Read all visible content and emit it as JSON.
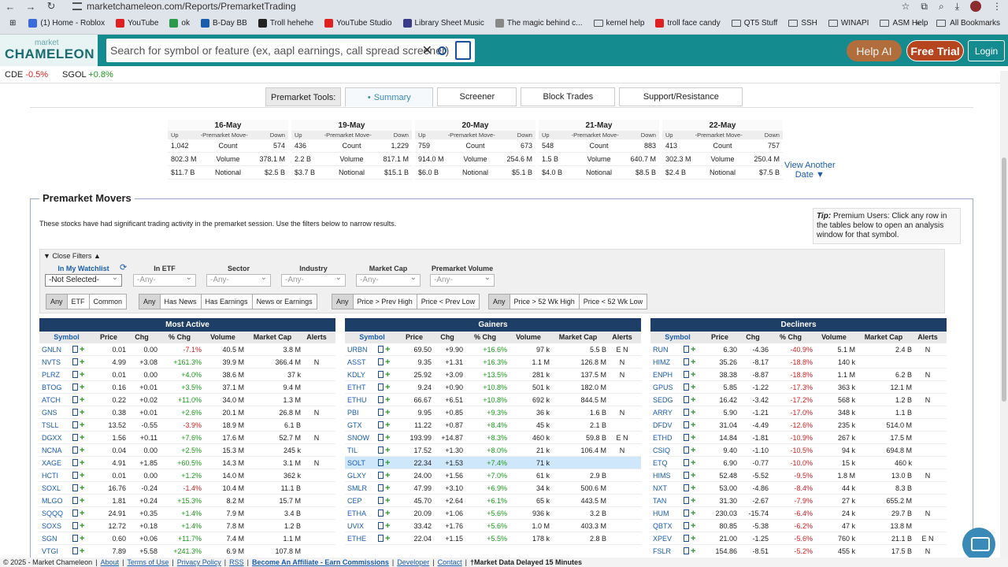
{
  "browser": {
    "url": "marketchameleon.com/Reports/PremarketTrading",
    "bookmarks": [
      "(1) Home - Roblox",
      "YouTube",
      "ok",
      "B-Day BB",
      "Troll hehehe",
      "YouTube Studio",
      "Library Sheet Music",
      "The magic behind c...",
      "kernel help",
      "troll face candy",
      "QT5 Stuff",
      "SSH",
      "WINAPI",
      "ASM Help"
    ],
    "all_bookmarks": "All Bookmarks",
    "bookmark_colors": [
      "#3a6bd8",
      "#e02020",
      "#2a9a4a",
      "#1a5cae",
      "#222",
      "#e02020",
      "#3a3a8a",
      "#888",
      "#555",
      "#e02020",
      "#555",
      "#555",
      "#555",
      "#555"
    ]
  },
  "header": {
    "logo_top": "market",
    "logo_main": "CHAMELEON",
    "search_placeholder": "Search for symbol or feature (ex, aapl earnings, call spread screener)",
    "help": "Help AI",
    "trial": "Free Trial",
    "login": "Login"
  },
  "tickers": [
    {
      "sym": "CDE",
      "chg": "-0.5%",
      "dir": "neg"
    },
    {
      "sym": "SGOL",
      "chg": "+0.8%",
      "dir": "pos"
    }
  ],
  "tabs": {
    "label": "Premarket Tools:",
    "items": [
      "Summary",
      "Screener",
      "Block Trades",
      "Support/Resistance"
    ]
  },
  "daycard_sub": [
    "Up",
    "-Premarket Move-",
    "Down"
  ],
  "days": [
    {
      "date": "16-May",
      "rows": [
        [
          "1,042",
          "Count",
          "574"
        ],
        [
          "802.3 M",
          "Volume",
          "378.1 M"
        ],
        [
          "$11.7 B",
          "Notional",
          "$2.5 B"
        ]
      ]
    },
    {
      "date": "19-May",
      "rows": [
        [
          "436",
          "Count",
          "1,229"
        ],
        [
          "2.2 B",
          "Volume",
          "817.1 M"
        ],
        [
          "$3.7 B",
          "Notional",
          "$15.1 B"
        ]
      ]
    },
    {
      "date": "20-May",
      "rows": [
        [
          "759",
          "Count",
          "673"
        ],
        [
          "914.0 M",
          "Volume",
          "254.6 M"
        ],
        [
          "$6.0 B",
          "Notional",
          "$5.1 B"
        ]
      ]
    },
    {
      "date": "21-May",
      "rows": [
        [
          "548",
          "Count",
          "883"
        ],
        [
          "1.5 B",
          "Volume",
          "640.7 M"
        ],
        [
          "$4.0 B",
          "Notional",
          "$8.5 B"
        ]
      ]
    },
    {
      "date": "22-May",
      "rows": [
        [
          "413",
          "Count",
          "757"
        ],
        [
          "302.3 M",
          "Volume",
          "250.4 M"
        ],
        [
          "$2.4 B",
          "Notional",
          "$7.5 B"
        ]
      ]
    }
  ],
  "view_another": [
    "View Another",
    "Date ▼"
  ],
  "movers": {
    "title": "Premarket Movers",
    "intro": "These stocks have had significant trading activity in the premarket session. Use the filters below to narrow results.",
    "tip_label": "Tip:",
    "tip_text": "Premium Users: Click any row in the tables below to open an analysis window for that symbol."
  },
  "filters": {
    "toggle": "Close Filters",
    "cols": [
      {
        "label": "In My Watchlist",
        "value": "-Not Selected-"
      },
      {
        "label": "In ETF",
        "value": "-Any-"
      },
      {
        "label": "Sector",
        "value": "-Any-"
      },
      {
        "label": "Industry",
        "value": "-Any-"
      },
      {
        "label": "Market Cap",
        "value": "-Any-"
      },
      {
        "label": "Premarket Volume",
        "value": "-Any-"
      }
    ],
    "groups": [
      [
        "Any",
        "ETF",
        "Common"
      ],
      [
        "Any",
        "Has News",
        "Has Earnings",
        "News or Earnings"
      ],
      [
        "Any",
        "Price > Prev High",
        "Price < Prev Low"
      ],
      [
        "Any",
        "Price > 52 Wk High",
        "Price < 52 Wk Low"
      ]
    ]
  },
  "table_headers": [
    "Symbol",
    "Price",
    "Chg",
    "% Chg",
    "Volume",
    "Market Cap",
    "Alerts"
  ],
  "tables": [
    {
      "title": "Most Active",
      "rows": [
        [
          "GNLN",
          "0.01",
          "0.00",
          "-7.1%",
          "40.5 M",
          "3.8 M",
          ""
        ],
        [
          "NVTS",
          "4.99",
          "+3.08",
          "+161.3%",
          "39.9 M",
          "366.4 M",
          "N"
        ],
        [
          "PLRZ",
          "0.01",
          "0.00",
          "+4.0%",
          "38.6 M",
          "37 k",
          ""
        ],
        [
          "BTOG",
          "0.16",
          "+0.01",
          "+3.5%",
          "37.1 M",
          "9.4 M",
          ""
        ],
        [
          "ATCH",
          "0.22",
          "+0.02",
          "+11.0%",
          "34.0 M",
          "1.3 M",
          ""
        ],
        [
          "GNS",
          "0.38",
          "+0.01",
          "+2.6%",
          "20.1 M",
          "26.8 M",
          "N"
        ],
        [
          "TSLL",
          "13.52",
          "-0.55",
          "-3.9%",
          "18.9 M",
          "6.1 B",
          ""
        ],
        [
          "DGXX",
          "1.56",
          "+0.11",
          "+7.6%",
          "17.6 M",
          "52.7 M",
          "N"
        ],
        [
          "NCNA",
          "0.04",
          "0.00",
          "+2.5%",
          "15.3 M",
          "245 k",
          ""
        ],
        [
          "XAGE",
          "4.91",
          "+1.85",
          "+60.5%",
          "14.3 M",
          "3.1 M",
          "N"
        ],
        [
          "HCTI",
          "0.01",
          "0.00",
          "+1.2%",
          "14.0 M",
          "362 k",
          ""
        ],
        [
          "SOXL",
          "16.76",
          "-0.24",
          "-1.4%",
          "10.4 M",
          "11.1 B",
          ""
        ],
        [
          "MLGO",
          "1.81",
          "+0.24",
          "+15.3%",
          "8.2 M",
          "15.7 M",
          ""
        ],
        [
          "SQQQ",
          "24.91",
          "+0.35",
          "+1.4%",
          "7.9 M",
          "3.4 B",
          ""
        ],
        [
          "SOXS",
          "12.72",
          "+0.18",
          "+1.4%",
          "7.8 M",
          "1.2 B",
          ""
        ],
        [
          "SGN",
          "0.60",
          "+0.06",
          "+11.7%",
          "7.4 M",
          "1.1 M",
          ""
        ],
        [
          "VTGI",
          "7.89",
          "+5.58",
          "+241.3%",
          "6.9 M",
          "107.8 M",
          ""
        ]
      ]
    },
    {
      "title": "Gainers",
      "rows": [
        [
          "URBN",
          "69.50",
          "+9.90",
          "+16.6%",
          "97 k",
          "5.5 B",
          "E N"
        ],
        [
          "ASST",
          "9.35",
          "+1.31",
          "+16.3%",
          "1.1 M",
          "126.8 M",
          "N"
        ],
        [
          "KDLY",
          "25.92",
          "+3.09",
          "+13.5%",
          "281 k",
          "137.5 M",
          "N"
        ],
        [
          "ETHT",
          "9.24",
          "+0.90",
          "+10.8%",
          "501 k",
          "182.0 M",
          ""
        ],
        [
          "ETHU",
          "66.67",
          "+6.51",
          "+10.8%",
          "692 k",
          "844.5 M",
          ""
        ],
        [
          "PBI",
          "9.95",
          "+0.85",
          "+9.3%",
          "36 k",
          "1.6 B",
          "N"
        ],
        [
          "GTX",
          "11.22",
          "+0.87",
          "+8.4%",
          "45 k",
          "2.1 B",
          ""
        ],
        [
          "SNOW",
          "193.99",
          "+14.87",
          "+8.3%",
          "460 k",
          "59.8 B",
          "E N"
        ],
        [
          "TIL",
          "17.52",
          "+1.30",
          "+8.0%",
          "21 k",
          "106.4 M",
          "N"
        ],
        [
          "SOLT",
          "22.34",
          "+1.53",
          "+7.4%",
          "71 k",
          "",
          ""
        ],
        [
          "GLXY",
          "24.00",
          "+1.56",
          "+7.0%",
          "61 k",
          "2.9 B",
          ""
        ],
        [
          "SMLR",
          "47.99",
          "+3.10",
          "+6.9%",
          "34 k",
          "500.6 M",
          ""
        ],
        [
          "CEP",
          "45.70",
          "+2.64",
          "+6.1%",
          "65 k",
          "443.5 M",
          ""
        ],
        [
          "ETHA",
          "20.09",
          "+1.06",
          "+5.6%",
          "936 k",
          "3.2 B",
          ""
        ],
        [
          "UVIX",
          "33.42",
          "+1.76",
          "+5.6%",
          "1.0 M",
          "403.3 M",
          ""
        ],
        [
          "ETHE",
          "22.04",
          "+1.15",
          "+5.5%",
          "178 k",
          "2.8 B",
          ""
        ]
      ]
    },
    {
      "title": "Decliners",
      "rows": [
        [
          "RUN",
          "6.30",
          "-4.36",
          "-40.9%",
          "5.1 M",
          "2.4 B",
          "N"
        ],
        [
          "HIMZ",
          "35.26",
          "-8.17",
          "-18.8%",
          "140 k",
          "",
          ""
        ],
        [
          "ENPH",
          "38.38",
          "-8.87",
          "-18.8%",
          "1.1 M",
          "6.2 B",
          "N"
        ],
        [
          "GPUS",
          "5.85",
          "-1.22",
          "-17.3%",
          "363 k",
          "12.1 M",
          ""
        ],
        [
          "SEDG",
          "16.42",
          "-3.42",
          "-17.2%",
          "568 k",
          "1.2 B",
          "N"
        ],
        [
          "ARRY",
          "5.90",
          "-1.21",
          "-17.0%",
          "348 k",
          "1.1 B",
          ""
        ],
        [
          "DFDV",
          "31.04",
          "-4.49",
          "-12.6%",
          "235 k",
          "514.0 M",
          ""
        ],
        [
          "ETHD",
          "14.84",
          "-1.81",
          "-10.9%",
          "267 k",
          "17.5 M",
          ""
        ],
        [
          "CSIQ",
          "9.40",
          "-1.10",
          "-10.5%",
          "94 k",
          "694.8 M",
          ""
        ],
        [
          "ETQ",
          "6.90",
          "-0.77",
          "-10.0%",
          "15 k",
          "460 k",
          ""
        ],
        [
          "HIMS",
          "52.48",
          "-5.52",
          "-9.5%",
          "1.8 M",
          "13.0 B",
          "N"
        ],
        [
          "NXT",
          "53.00",
          "-4.86",
          "-8.4%",
          "44 k",
          "8.3 B",
          ""
        ],
        [
          "TAN",
          "31.30",
          "-2.67",
          "-7.9%",
          "27 k",
          "655.2 M",
          ""
        ],
        [
          "HUM",
          "230.03",
          "-15.74",
          "-6.4%",
          "24 k",
          "29.7 B",
          "N"
        ],
        [
          "QBTX",
          "80.85",
          "-5.38",
          "-6.2%",
          "47 k",
          "13.8 M",
          ""
        ],
        [
          "XPEV",
          "21.00",
          "-1.25",
          "-5.6%",
          "760 k",
          "21.1 B",
          "E N"
        ],
        [
          "FSLR",
          "154.86",
          "-8.51",
          "-5.2%",
          "455 k",
          "17.5 B",
          "N"
        ]
      ]
    }
  ],
  "footer": [
    "© 2025 - Market Chameleon",
    "About",
    "Terms of Use",
    "Privacy Policy",
    "RSS",
    "Become An Affiliate - Earn Commissions",
    "Developer",
    "Contact",
    "†Market Data Delayed 15 Minutes"
  ]
}
